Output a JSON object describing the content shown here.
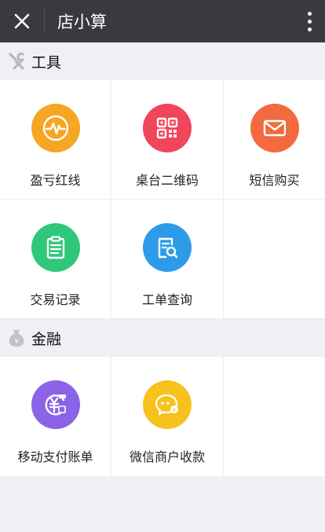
{
  "titlebar": {
    "title": "店小算",
    "close_icon": "close-icon",
    "more_icon": "more-vertical-icon"
  },
  "sections": [
    {
      "title": "工具",
      "icon": "tools-icon",
      "items": [
        {
          "label": "盈亏红线",
          "icon": "pulse-icon",
          "color": "#f5a623"
        },
        {
          "label": "桌台二维码",
          "icon": "qrcode-icon",
          "color": "#f0455b"
        },
        {
          "label": "短信购买",
          "icon": "mail-icon",
          "color": "#f26a3d"
        },
        {
          "label": "交易记录",
          "icon": "clipboard-icon",
          "color": "#2fc77a"
        },
        {
          "label": "工单查询",
          "icon": "document-search-icon",
          "color": "#2d9be8"
        }
      ]
    },
    {
      "title": "金融",
      "icon": "money-bag-icon",
      "items": [
        {
          "label": "移动支付账单",
          "icon": "yuan-bill-icon",
          "color": "#8a63e6"
        },
        {
          "label": "微信商户收款",
          "icon": "wechat-pay-icon",
          "color": "#f7c21e"
        }
      ]
    }
  ]
}
